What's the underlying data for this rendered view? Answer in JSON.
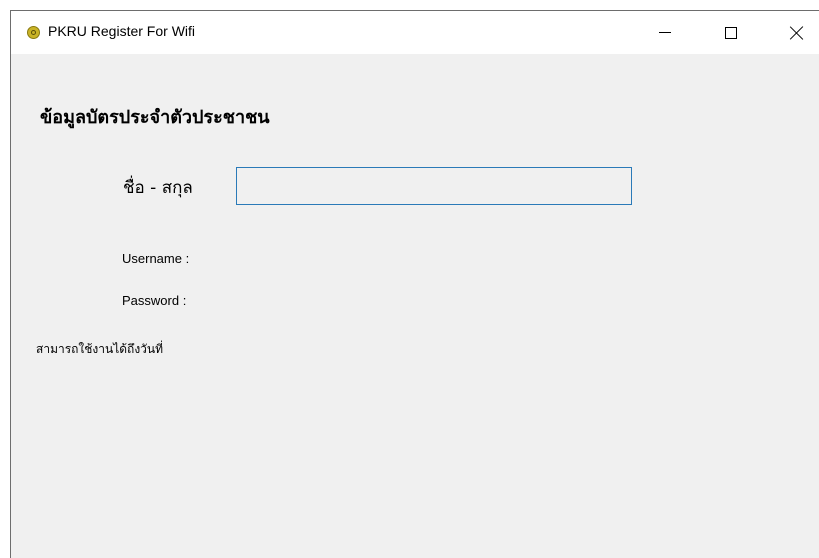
{
  "window": {
    "title": "PKRU Register For Wifi",
    "icon": "wifi-app-icon",
    "controls": {
      "minimize_icon": "minimize-icon",
      "maximize_icon": "maximize-icon",
      "close_icon": "close-icon"
    }
  },
  "form": {
    "heading": "ข้อมูลบัตรประจำตัวประชาชน",
    "name_label": "ชื่อ - สกุล",
    "name_value": "",
    "username_label": "Username :",
    "password_label": "Password :",
    "expire_label": "สามารถใช้งานได้ถึงวันที่"
  },
  "colors": {
    "input_border": "#2a7ab8",
    "window_bg": "#f0f0f0",
    "titlebar_bg": "#ffffff"
  }
}
